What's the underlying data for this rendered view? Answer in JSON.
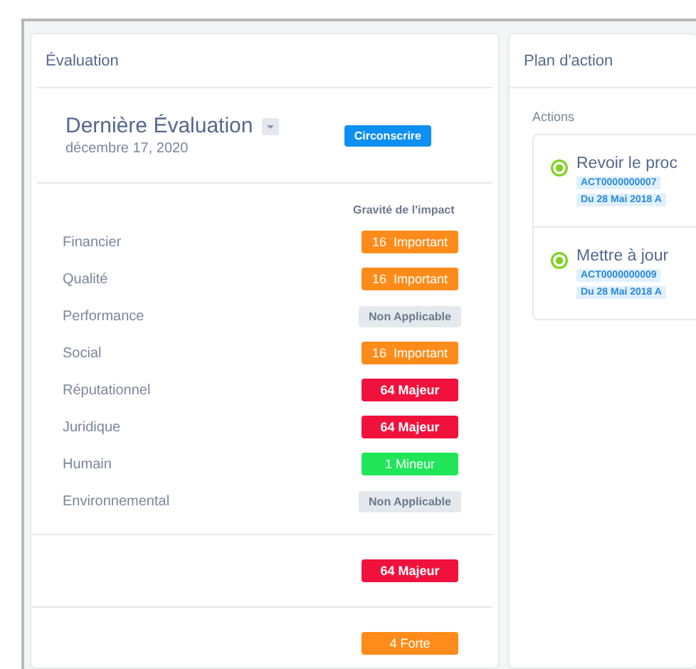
{
  "evaluation": {
    "title": "Évaluation",
    "latest": {
      "heading": "Dernière Évaluation",
      "date": "décembre 17, 2020",
      "status": "Circonscrire"
    },
    "column_header": "Gravité de l'impact",
    "rows": [
      {
        "label": "Financier",
        "badge": {
          "text": "16  Important",
          "kind": "important"
        }
      },
      {
        "label": "Qualité",
        "badge": {
          "text": "16  Important",
          "kind": "important"
        }
      },
      {
        "label": "Performance",
        "badge": {
          "text": "Non Applicable",
          "kind": "na"
        }
      },
      {
        "label": "Social",
        "badge": {
          "text": "16  Important",
          "kind": "important"
        }
      },
      {
        "label": "Réputationnel",
        "badge": {
          "text": "64 Majeur",
          "kind": "major"
        }
      },
      {
        "label": "Juridique",
        "badge": {
          "text": "64 Majeur",
          "kind": "major"
        }
      },
      {
        "label": "Humain",
        "badge": {
          "text": "1 Mineur",
          "kind": "minor"
        }
      },
      {
        "label": "Environnemental",
        "badge": {
          "text": "Non Applicable",
          "kind": "na"
        }
      }
    ],
    "summary_badges": [
      {
        "text": "64 Majeur",
        "kind": "major"
      },
      {
        "text": "4 Forte",
        "kind": "important"
      }
    ]
  },
  "action_plan": {
    "title": "Plan d'action",
    "section": "Actions",
    "actions": [
      {
        "title": "Revoir le proc",
        "code": "ACT0000000007",
        "dates": "Du 28 Mai 2018 A"
      },
      {
        "title": "Mettre à jour",
        "code": "ACT0000000009",
        "dates": "Du 28 Mai 2018 A"
      }
    ]
  }
}
